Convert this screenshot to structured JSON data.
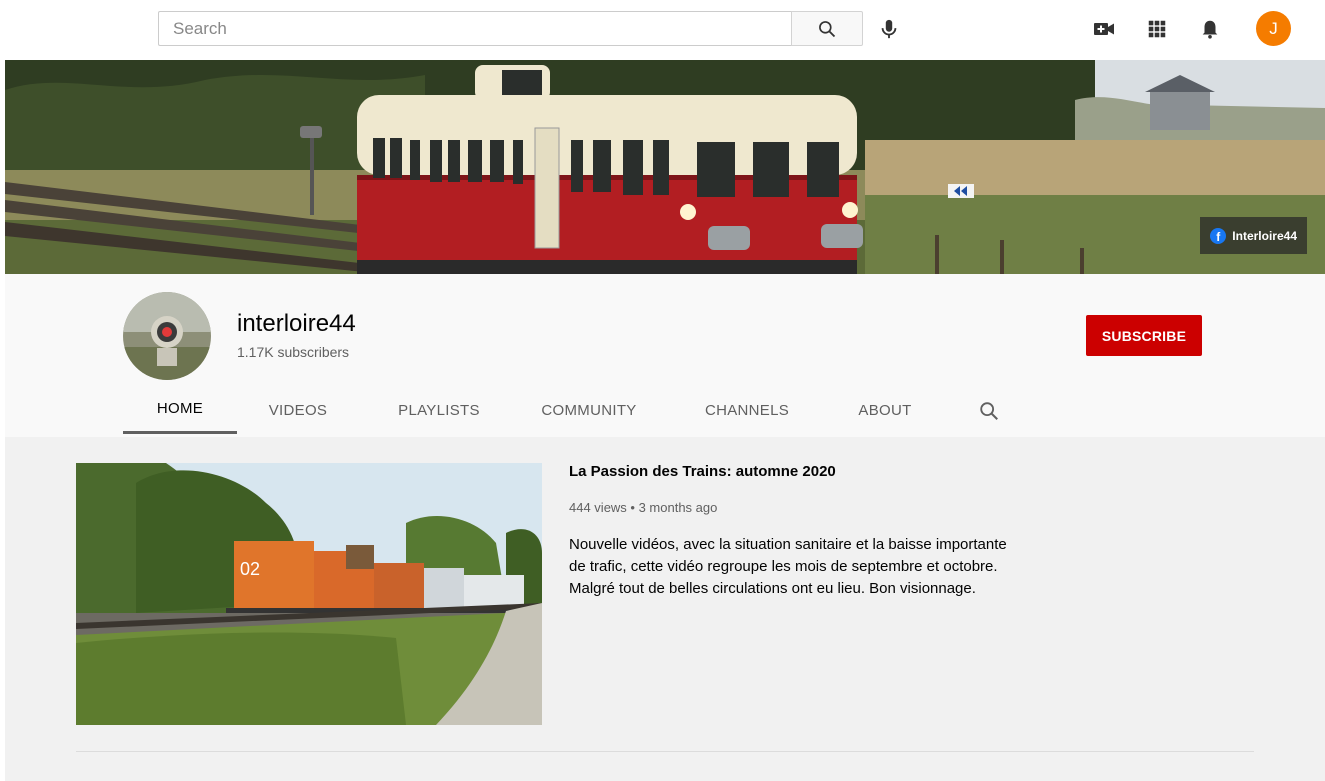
{
  "topbar": {
    "search_placeholder": "Search",
    "avatar_letter": "J",
    "icons": [
      "search-icon",
      "microphone-icon",
      "create-video-icon",
      "apps-grid-icon",
      "notifications-bell-icon"
    ],
    "avatar_color": "#f57c00"
  },
  "banner": {
    "facebook_label": "Interloire44"
  },
  "channel": {
    "name": "interloire44",
    "subscribers": "1.17K subscribers",
    "subscribe_label": "SUBSCRIBE",
    "subscribe_color": "#cc0000"
  },
  "tabs": [
    {
      "label": "HOME",
      "active": true
    },
    {
      "label": "VIDEOS",
      "active": false
    },
    {
      "label": "PLAYLISTS",
      "active": false
    },
    {
      "label": "COMMUNITY",
      "active": false
    },
    {
      "label": "CHANNELS",
      "active": false
    },
    {
      "label": "ABOUT",
      "active": false
    }
  ],
  "featured_video": {
    "title": "La Passion des Trains: automne 2020",
    "meta": "444 views • 3 months ago",
    "description": "Nouvelle vidéos, avec la situation sanitaire et la baisse importante de trafic, cette vidéo regroupe les mois de septembre et octobre. Malgré tout de belles circulations ont eu lieu. Bon visionnage."
  }
}
